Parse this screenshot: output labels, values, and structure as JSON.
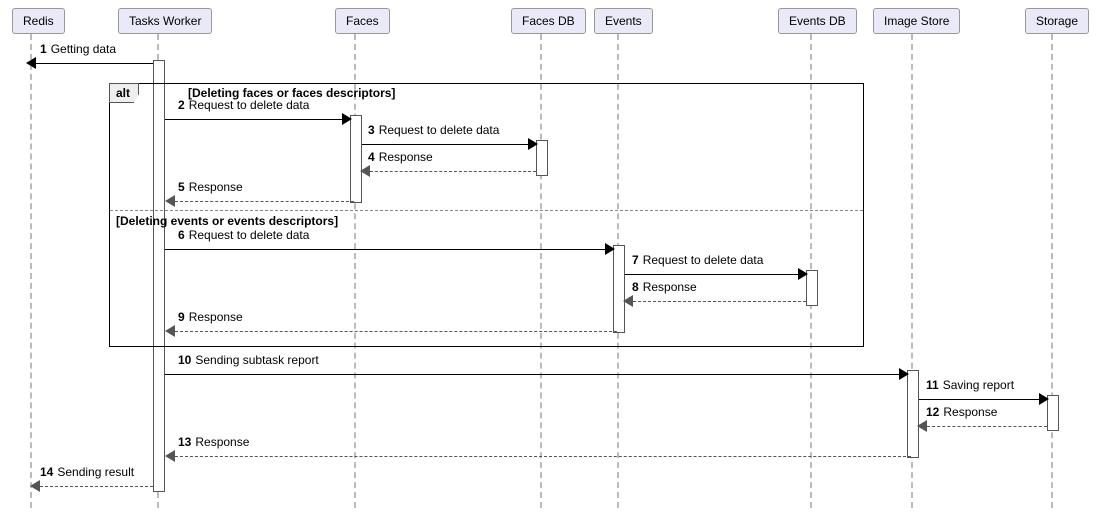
{
  "chart_data": {
    "type": "sequence-diagram",
    "actors": [
      "Redis",
      "Tasks Worker",
      "Faces",
      "Faces DB",
      "Events",
      "Events DB",
      "Image Store",
      "Storage"
    ],
    "fragments": [
      {
        "type": "alt",
        "guards": [
          "Deleting faces or faces descriptors",
          "Deleting events or events descriptors"
        ],
        "message_ranges": [
          [
            2,
            5
          ],
          [
            6,
            9
          ]
        ]
      }
    ],
    "messages": [
      {
        "n": 1,
        "from": "Tasks Worker",
        "to": "Redis",
        "text": "Getting data",
        "reply": false
      },
      {
        "n": 2,
        "from": "Tasks Worker",
        "to": "Faces",
        "text": "Request to delete data",
        "reply": false
      },
      {
        "n": 3,
        "from": "Faces",
        "to": "Faces DB",
        "text": "Request to delete data",
        "reply": false
      },
      {
        "n": 4,
        "from": "Faces DB",
        "to": "Faces",
        "text": "Response",
        "reply": true
      },
      {
        "n": 5,
        "from": "Faces",
        "to": "Tasks Worker",
        "text": "Response",
        "reply": true
      },
      {
        "n": 6,
        "from": "Tasks Worker",
        "to": "Events",
        "text": "Request to delete data",
        "reply": false
      },
      {
        "n": 7,
        "from": "Events",
        "to": "Events DB",
        "text": "Request to delete data",
        "reply": false
      },
      {
        "n": 8,
        "from": "Events DB",
        "to": "Events",
        "text": "Response",
        "reply": true
      },
      {
        "n": 9,
        "from": "Events",
        "to": "Tasks Worker",
        "text": "Response",
        "reply": true
      },
      {
        "n": 10,
        "from": "Tasks Worker",
        "to": "Image Store",
        "text": "Sending subtask report",
        "reply": false
      },
      {
        "n": 11,
        "from": "Image Store",
        "to": "Storage",
        "text": "Saving report",
        "reply": false
      },
      {
        "n": 12,
        "from": "Storage",
        "to": "Image Store",
        "text": "Response",
        "reply": true
      },
      {
        "n": 13,
        "from": "Image Store",
        "to": "Tasks Worker",
        "text": "Response",
        "reply": true
      },
      {
        "n": 14,
        "from": "Tasks Worker",
        "to": "Redis",
        "text": "Sending result",
        "reply": true
      }
    ]
  },
  "actors": {
    "redis": "Redis",
    "tasks": "Tasks Worker",
    "faces": "Faces",
    "facesdb": "Faces DB",
    "events": "Events",
    "eventsdb": "Events DB",
    "imagestore": "Image Store",
    "storage": "Storage"
  },
  "alt": {
    "label": "alt",
    "guard1": "[Deleting faces or faces descriptors]",
    "guard2": "[Deleting events or events descriptors]"
  },
  "m1": {
    "n": "1",
    "t": "Getting data"
  },
  "m2": {
    "n": "2",
    "t": "Request to delete data"
  },
  "m3": {
    "n": "3",
    "t": "Request to delete data"
  },
  "m4": {
    "n": "4",
    "t": "Response"
  },
  "m5": {
    "n": "5",
    "t": "Response"
  },
  "m6": {
    "n": "6",
    "t": "Request to delete data"
  },
  "m7": {
    "n": "7",
    "t": "Request to delete data"
  },
  "m8": {
    "n": "8",
    "t": "Response"
  },
  "m9": {
    "n": "9",
    "t": "Response"
  },
  "m10": {
    "n": "10",
    "t": "Sending subtask report"
  },
  "m11": {
    "n": "11",
    "t": "Saving report"
  },
  "m12": {
    "n": "12",
    "t": "Response"
  },
  "m13": {
    "n": "13",
    "t": "Response"
  },
  "m14": {
    "n": "14",
    "t": "Sending result"
  }
}
